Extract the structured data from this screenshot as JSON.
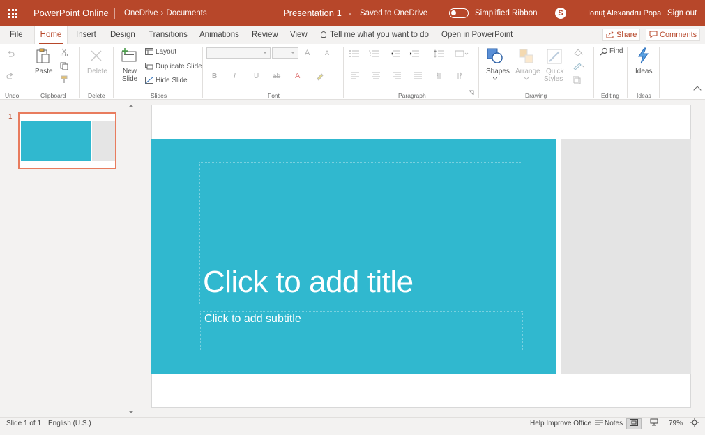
{
  "titlebar": {
    "app_name": "PowerPoint Online",
    "breadcrumb_root": "OneDrive",
    "breadcrumb_sep": "›",
    "breadcrumb_folder": "Documents",
    "doc_title": "Presentation 1",
    "dash": "-",
    "save_status": "Saved to OneDrive",
    "simplified_ribbon_label": "Simplified Ribbon",
    "skype_glyph": "S",
    "user_name": "Ionuț Alexandru Popa",
    "sign_out": "Sign out",
    "accent_color": "#b7472a"
  },
  "tabs": [
    {
      "label": "File"
    },
    {
      "label": "Home",
      "active": true
    },
    {
      "label": "Insert"
    },
    {
      "label": "Design"
    },
    {
      "label": "Transitions"
    },
    {
      "label": "Animations"
    },
    {
      "label": "Review"
    },
    {
      "label": "View"
    }
  ],
  "tell_me": "Tell me what you want to do",
  "open_in": "Open in PowerPoint",
  "share_label": "Share",
  "comments_label": "Comments",
  "ribbon": {
    "groups": {
      "undo": "Undo",
      "clipboard": "Clipboard",
      "delete": "Delete",
      "slides": "Slides",
      "font": "Font",
      "paragraph": "Paragraph",
      "drawing": "Drawing",
      "editing": "Editing",
      "ideas": "Ideas"
    },
    "paste": "Paste",
    "delete": "Delete",
    "new_slide_1": "New",
    "new_slide_2": "Slide",
    "layout": "Layout",
    "duplicate_slide": "Duplicate Slide",
    "hide_slide": "Hide Slide",
    "shapes": "Shapes",
    "arrange": "Arrange",
    "quick_1": "Quick",
    "quick_2": "Styles",
    "find": "Find",
    "ideas": "Ideas",
    "font_glyphs": {
      "bold": "B",
      "italic": "I",
      "underline": "U",
      "strike": "ab",
      "font_color": "A",
      "grow": "A",
      "shrink": "A"
    }
  },
  "thumbnail": {
    "number": "1"
  },
  "slide": {
    "title_placeholder": "Click to add title",
    "subtitle_placeholder": "Click to add subtitle",
    "bg_color": "#30b8cf"
  },
  "status": {
    "slide_count": "Slide 1 of 1",
    "language": "English (U.S.)",
    "help": "Help Improve Office",
    "notes": "Notes",
    "zoom": "79%"
  }
}
